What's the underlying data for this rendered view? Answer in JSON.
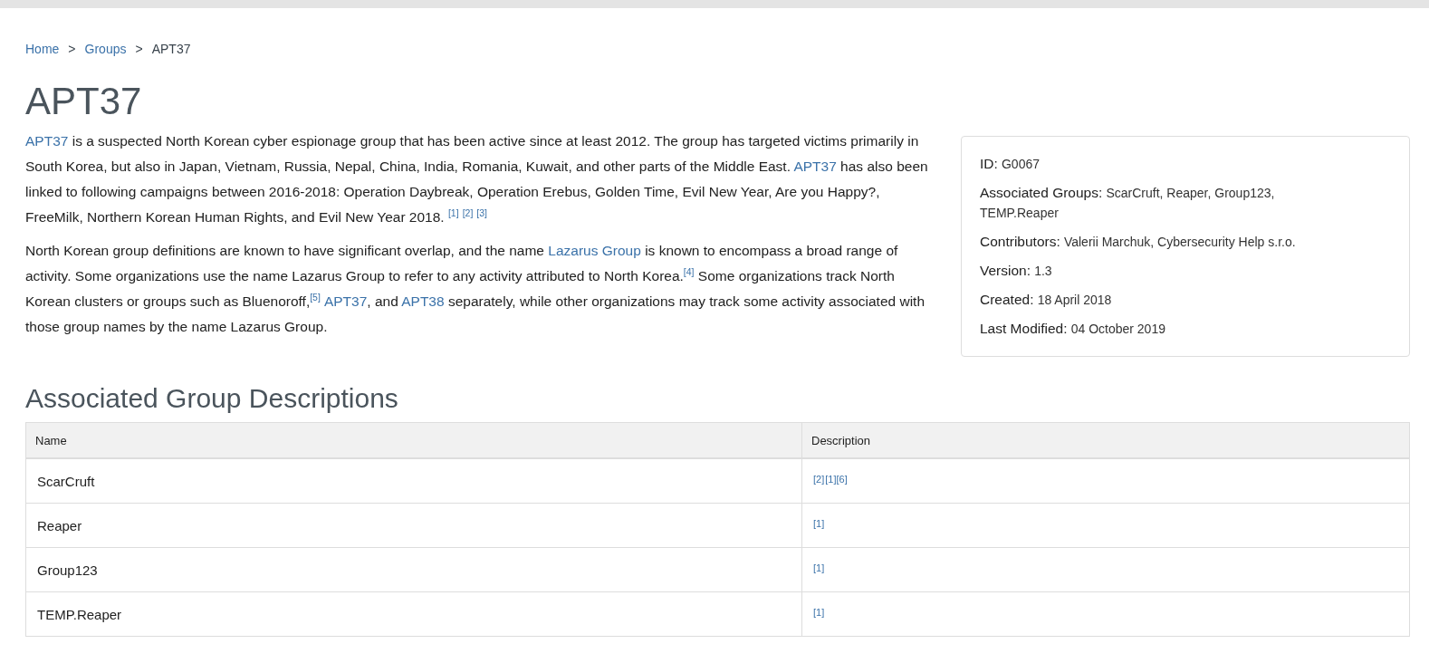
{
  "breadcrumb": [
    {
      "text": "Home",
      "kind": "link"
    },
    {
      "text": ">",
      "kind": "separator"
    },
    {
      "text": "Groups",
      "kind": "link"
    },
    {
      "text": ">",
      "kind": "separator"
    },
    {
      "text": "APT37",
      "kind": "current"
    }
  ],
  "title": "APT37",
  "description": [
    [
      {
        "kind": "link",
        "text": "APT37"
      },
      {
        "kind": "text",
        "text": " is a suspected North Korean cyber espionage group that has been active since at least 2012. The group has targeted victims primarily in South Korea, but also in Japan, Vietnam, Russia, Nepal, China, India, Romania, Kuwait, and other parts of the Middle East. "
      },
      {
        "kind": "link",
        "text": "APT37"
      },
      {
        "kind": "text",
        "text": " has also been linked to following campaigns between 2016-2018: Operation Daybreak, Operation Erebus, Golden Time, Evil New Year, Are you Happy?, FreeMilk, Northern Korean Human Rights, and Evil New Year 2018. "
      },
      {
        "kind": "refs",
        "items": [
          "[1]",
          "[2]",
          "[3]"
        ]
      }
    ],
    [
      {
        "kind": "text",
        "text": "North Korean group definitions are known to have significant overlap, and the name "
      },
      {
        "kind": "link",
        "text": "Lazarus Group"
      },
      {
        "kind": "text",
        "text": " is known to encompass a broad range of activity. Some organizations use the name Lazarus Group to refer to any activity attributed to North Korea."
      },
      {
        "kind": "ref",
        "text": "[4]"
      },
      {
        "kind": "text",
        "text": " Some organizations track North Korean clusters or groups such as Bluenoroff,"
      },
      {
        "kind": "ref",
        "text": "[5]"
      },
      {
        "kind": "link",
        "text": "APT37",
        "space_before": true
      },
      {
        "kind": "text",
        "text": ", and "
      },
      {
        "kind": "link",
        "text": "APT38"
      },
      {
        "kind": "text",
        "text": " separately, while other organizations may track some activity associated with those group names by the name Lazarus Group."
      }
    ]
  ],
  "info_card": [
    {
      "label": "ID:",
      "value": "G0067"
    },
    {
      "label": "Associated Groups:",
      "value": "ScarCruft, Reaper, Group123, TEMP.Reaper"
    },
    {
      "label": "Contributors:",
      "value": "Valerii Marchuk, Cybersecurity Help s.r.o."
    },
    {
      "label": "Version:",
      "value": "1.3"
    },
    {
      "label": "Created:",
      "value": "18 April 2018"
    },
    {
      "label": "Last Modified:",
      "value": "04 October 2019"
    }
  ],
  "section_title": "Associated Group Descriptions",
  "table": {
    "columns": [
      "Name",
      "Description"
    ],
    "rows": [
      {
        "name": "ScarCruft",
        "description": [
          "[2]",
          "[1]",
          "[6]"
        ]
      },
      {
        "name": "Reaper",
        "description": [
          "[1]"
        ]
      },
      {
        "name": "Group123",
        "description": [
          "[1]"
        ]
      },
      {
        "name": "TEMP.Reaper",
        "description": [
          "[1]"
        ]
      }
    ]
  }
}
